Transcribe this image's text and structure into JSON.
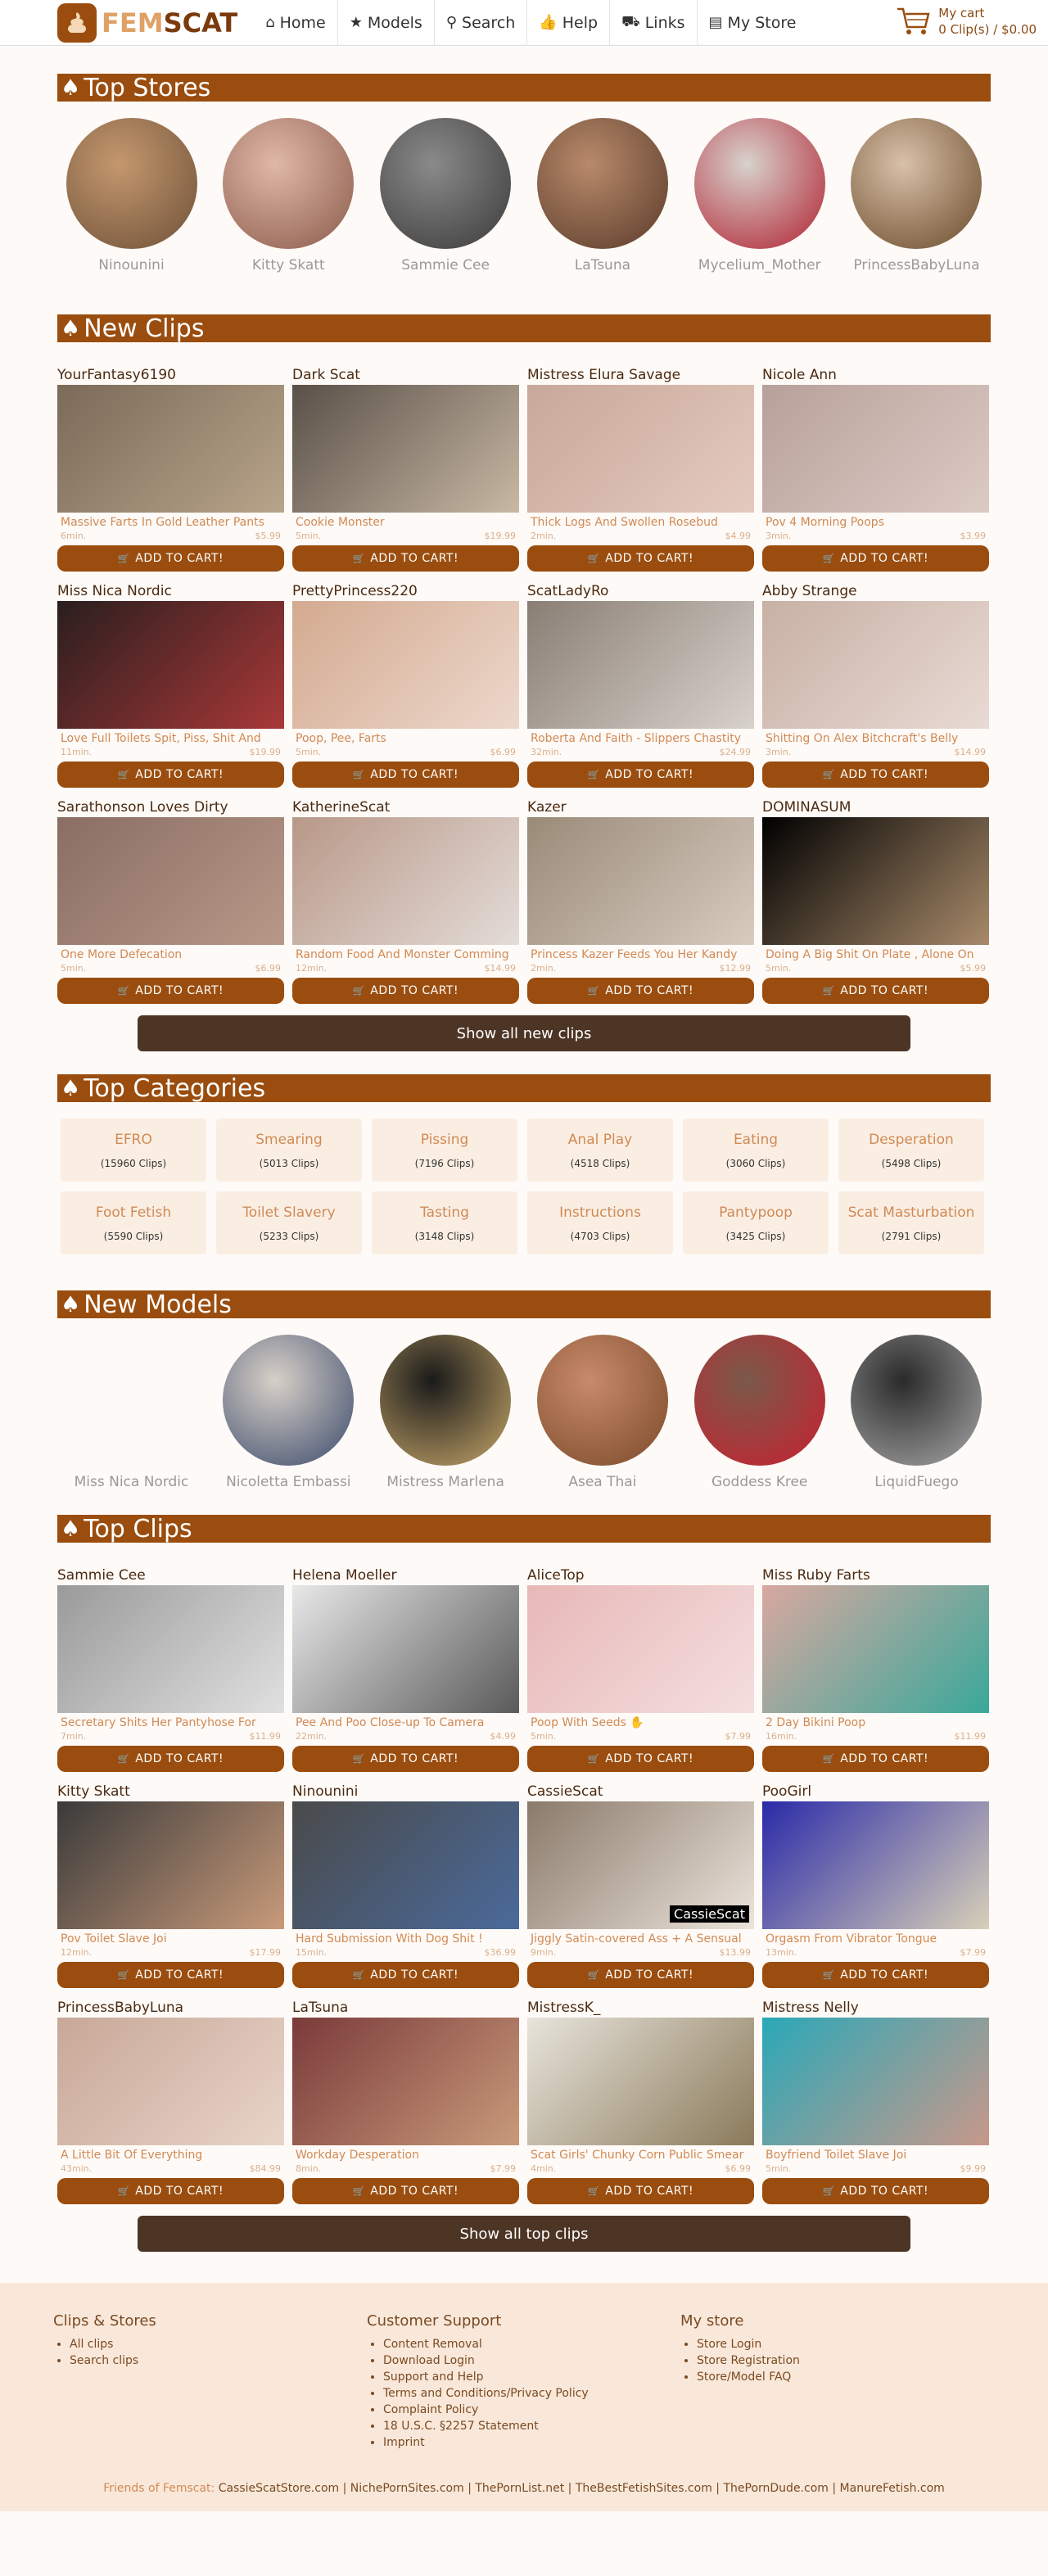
{
  "nav": {
    "logo_fem": "FEM",
    "logo_scat": "SCAT",
    "items": [
      {
        "label": "Home",
        "icon": "home-icon",
        "glyph": "⌂"
      },
      {
        "label": "Models",
        "icon": "star-icon",
        "glyph": "★"
      },
      {
        "label": "Search",
        "icon": "search-icon",
        "glyph": "⚲"
      },
      {
        "label": "Help",
        "icon": "thumbs-up-icon",
        "glyph": "👍"
      },
      {
        "label": "Links",
        "icon": "road-icon",
        "glyph": "⛟"
      },
      {
        "label": "My Store",
        "icon": "store-icon",
        "glyph": "▤"
      }
    ],
    "cart_title": "My cart",
    "cart_summary": "0 Clip(s) / $0.00"
  },
  "colors": {
    "brand": "#9a4d0e",
    "accent": "#d08a55",
    "dark": "#4d3525"
  },
  "top_stores": {
    "title": "Top Stores",
    "items": [
      {
        "name": "Ninounini",
        "c1": "#c4986e",
        "c2": "#6e5038"
      },
      {
        "name": "Kitty Skatt",
        "c1": "#e0b8a8",
        "c2": "#8a5a4a"
      },
      {
        "name": "Sammie Cee",
        "c1": "#8a8a8a",
        "c2": "#3a3a3a"
      },
      {
        "name": "LaTsuna",
        "c1": "#b88a6a",
        "c2": "#5a3a2a"
      },
      {
        "name": "Mycelium_Mother",
        "c1": "#d8d2cc",
        "c2": "#b02030"
      },
      {
        "name": "PrincessBabyLuna",
        "c1": "#d8c0a8",
        "c2": "#6a4a2a"
      }
    ]
  },
  "new_clips": {
    "title": "New Clips",
    "show_all": "Show all new clips",
    "items": [
      {
        "model": "YourFantasy6190",
        "title": "Massive Farts In Gold Leather Pants",
        "duration": "6min.",
        "price": "$5.99",
        "c1": "#7a6a58",
        "c2": "#b8a48a"
      },
      {
        "model": "Dark Scat",
        "title": "Cookie Monster",
        "duration": "5min.",
        "price": "$19.99",
        "c1": "#5a5048",
        "c2": "#c8b8a4"
      },
      {
        "model": "Mistress Elura Savage",
        "title": "Thick Logs And Swollen Rosebud",
        "duration": "2min.",
        "price": "$4.99",
        "c1": "#c8a89a",
        "c2": "#e4cabe"
      },
      {
        "model": "Nicole Ann",
        "title": "Pov 4 Morning Poops",
        "duration": "3min.",
        "price": "$3.99",
        "c1": "#b8a09a",
        "c2": "#dccac4"
      },
      {
        "model": "Miss Nica Nordic",
        "title": "Love Full Toilets Spit, Piss, Shit And",
        "duration": "11min.",
        "price": "$19.99",
        "c1": "#2a1e1e",
        "c2": "#a83838"
      },
      {
        "model": "PrettyPrincess220",
        "title": "Poop, Pee, Farts",
        "duration": "5min.",
        "price": "$6.99",
        "c1": "#d4aa90",
        "c2": "#ecd8cc"
      },
      {
        "model": "ScatLadyRo",
        "title": "Roberta And Faith - Slippers Chastity",
        "duration": "32min.",
        "price": "$24.99",
        "c1": "#8a7e74",
        "c2": "#d8d2cc"
      },
      {
        "model": "Abby Strange",
        "title": "Shitting On Alex Bitchcraft's Belly",
        "duration": "3min.",
        "price": "$14.99",
        "c1": "#c8b0a4",
        "c2": "#e8dad4"
      },
      {
        "model": "Sarathonson Loves Dirty",
        "title": "One More Defecation",
        "duration": "5min.",
        "price": "$6.99",
        "c1": "#8a6e64",
        "c2": "#b89888"
      },
      {
        "model": "KatherineScat",
        "title": "Random Food And Monster Comming",
        "duration": "12min.",
        "price": "$14.99",
        "c1": "#b89888",
        "c2": "#e4dcd8"
      },
      {
        "model": "Kazer",
        "title": "Princess Kazer Feeds You Her Kandy",
        "duration": "2min.",
        "price": "$12.99",
        "c1": "#9a8a78",
        "c2": "#d8ccc0"
      },
      {
        "model": "DOMINASUM",
        "title": "Doing A Big Shit On Plate , Alone On",
        "duration": "5min.",
        "price": "$5.99",
        "c1": "#000000",
        "c2": "#a88a6a"
      }
    ]
  },
  "top_categories": {
    "title": "Top Categories",
    "items": [
      {
        "name": "EFRO",
        "count": "(15960 Clips)"
      },
      {
        "name": "Smearing",
        "count": "(5013 Clips)"
      },
      {
        "name": "Pissing",
        "count": "(7196 Clips)"
      },
      {
        "name": "Anal Play",
        "count": "(4518 Clips)"
      },
      {
        "name": "Eating",
        "count": "(3060 Clips)"
      },
      {
        "name": "Desperation",
        "count": "(5498 Clips)"
      },
      {
        "name": "Foot Fetish",
        "count": "(5590 Clips)"
      },
      {
        "name": "Toilet Slavery",
        "count": "(5233 Clips)"
      },
      {
        "name": "Tasting",
        "count": "(3148 Clips)"
      },
      {
        "name": "Instructions",
        "count": "(4703 Clips)"
      },
      {
        "name": "Pantypoop",
        "count": "(3425 Clips)"
      },
      {
        "name": "Scat Masturbation",
        "count": "(2791 Clips)"
      }
    ]
  },
  "new_models": {
    "title": "New Models",
    "items": [
      {
        "name": "Miss Nica Nordic",
        "c1": "",
        "c2": ""
      },
      {
        "name": "Nicoletta Embassi",
        "c1": "#d8d0c8",
        "c2": "#3a4a6a"
      },
      {
        "name": "Mistress Marlena",
        "c1": "#1a1a1a",
        "c2": "#c8a86a"
      },
      {
        "name": "Asea Thai",
        "c1": "#c88a6a",
        "c2": "#7a4a2a"
      },
      {
        "name": "Goddess Kree",
        "c1": "#7a5a4a",
        "c2": "#c82030"
      },
      {
        "name": "LiquidFuego",
        "c1": "#2a2a2a",
        "c2": "#a8a8a8"
      }
    ]
  },
  "top_clips": {
    "title": "Top Clips",
    "show_all": "Show all top clips",
    "items": [
      {
        "model": "Sammie Cee",
        "title": "Secretary Shits Her Pantyhose For",
        "duration": "7min.",
        "price": "$11.99",
        "c1": "#9a9a9a",
        "c2": "#e0e0e0",
        "tag": ""
      },
      {
        "model": "Helena Moeller",
        "title": "Pee And Poo Close-up To Camera",
        "duration": "22min.",
        "price": "$4.99",
        "c1": "#e8e8e8",
        "c2": "#5a5a5a",
        "tag": ""
      },
      {
        "model": "AliceTop",
        "title": "Poop With Seeds ✋",
        "duration": "5min.",
        "price": "$7.99",
        "c1": "#e8b8b8",
        "c2": "#f4dede",
        "tag": ""
      },
      {
        "model": "Miss Ruby Farts",
        "title": "2 Day Bikini Poop",
        "duration": "16min.",
        "price": "$11.99",
        "c1": "#d8a8a0",
        "c2": "#3aa89a",
        "tag": ""
      },
      {
        "model": "Kitty Skatt",
        "title": "Pov Toilet Slave Joi",
        "duration": "12min.",
        "price": "$17.99",
        "c1": "#3a3a3a",
        "c2": "#c89a7a",
        "tag": ""
      },
      {
        "model": "Ninounini",
        "title": "Hard Submission With Dog Shit !",
        "duration": "15min.",
        "price": "$36.99",
        "c1": "#4a4a4a",
        "c2": "#4a6a9a",
        "tag": ""
      },
      {
        "model": "CassieScat",
        "title": "Jiggly Satin-covered Ass + A Sensual",
        "duration": "9min.",
        "price": "$13.99",
        "c1": "#8a7a6a",
        "c2": "#ece4dc",
        "tag": "CassieScat"
      },
      {
        "model": "PooGirl",
        "title": "Orgasm From Vibrator Tongue",
        "duration": "13min.",
        "price": "$7.99",
        "c1": "#2a2aa8",
        "c2": "#d8d0b8",
        "tag": ""
      },
      {
        "model": "PrincessBabyLuna",
        "title": "A Little Bit Of Everything",
        "duration": "43min.",
        "price": "$84.99",
        "c1": "#c8a898",
        "c2": "#e8d4c8",
        "tag": ""
      },
      {
        "model": "LaTsuna",
        "title": "Workday Desperation",
        "duration": "8min.",
        "price": "$7.99",
        "c1": "#7a3a3a",
        "c2": "#c89a7a",
        "tag": ""
      },
      {
        "model": "MistressK_",
        "title": "Scat Girls' Chunky Corn Public Smear",
        "duration": "4min.",
        "price": "$6.99",
        "c1": "#e8e4dc",
        "c2": "#8a7a5a",
        "tag": ""
      },
      {
        "model": "Mistress Nelly",
        "title": "Boyfriend Toilet Slave Joi",
        "duration": "5min.",
        "price": "$9.99",
        "c1": "#2aa8b8",
        "c2": "#c8988a",
        "tag": ""
      }
    ]
  },
  "cart_button_label": "ADD TO CART!",
  "footer": {
    "clips_title": "Clips & Stores",
    "clips_links": [
      "All clips",
      "Search clips"
    ],
    "support_title": "Customer Support",
    "support_links": [
      "Content Removal",
      "Download Login",
      "Support and Help",
      "Terms and Conditions/Privacy Policy",
      "Complaint Policy",
      "18 U.S.C. §2257 Statement",
      "Imprint"
    ],
    "store_title": "My store",
    "store_links": [
      "Store Login",
      "Store Registration",
      "Store/Model FAQ"
    ],
    "friends_label": "Friends of Femscat:",
    "friends": [
      "CassieScatStore.com",
      "NichePornSites.com",
      "ThePornList.net",
      "TheBestFetishSites.com",
      "ThePornDude.com",
      "ManureFetish.com"
    ]
  }
}
